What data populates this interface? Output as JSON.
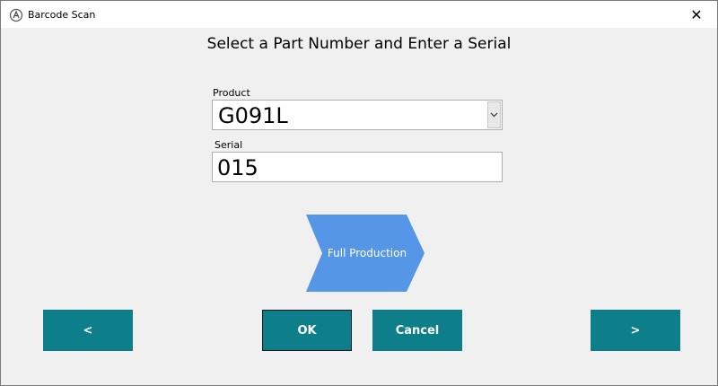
{
  "window": {
    "title": "Barcode Scan",
    "close_glyph": "✕"
  },
  "heading": "Select a Part Number and Enter a Serial",
  "product": {
    "label": "Product",
    "value": "G091L"
  },
  "serial": {
    "label": "Serial",
    "value": "015"
  },
  "mode_button": {
    "label": "Full Production",
    "color": "#5596e6"
  },
  "buttons": {
    "prev_label": "<",
    "ok_label": "OK",
    "cancel_label": "Cancel",
    "next_label": ">",
    "color": "#0d7f8a"
  },
  "icons": {
    "app": "barcode-app-icon",
    "close": "close-icon",
    "dropdown": "chevron-down-icon"
  }
}
